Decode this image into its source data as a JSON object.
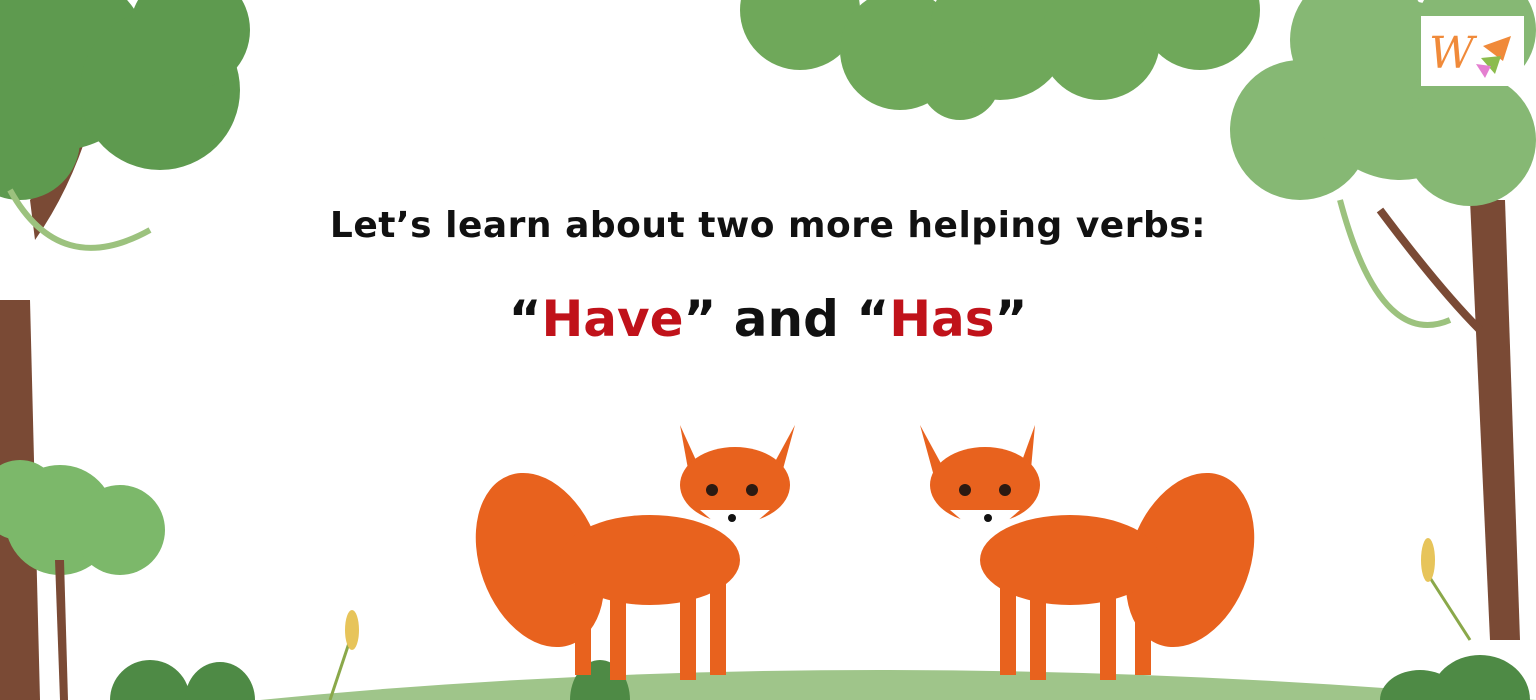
{
  "heading": "Let’s learn about two more helping verbs:",
  "subheading": {
    "open_quote_1": "“",
    "word_1": "Have",
    "close_and": "” and “",
    "word_2": "Has",
    "close_quote_2": "”"
  },
  "logo": {
    "letter": "W",
    "name": "logo-w-icon"
  },
  "colors": {
    "accent_red": "#c0121a",
    "fox_orange": "#e8621e",
    "foliage_green": "#6fa85a",
    "trunk_brown": "#7a4a35"
  }
}
